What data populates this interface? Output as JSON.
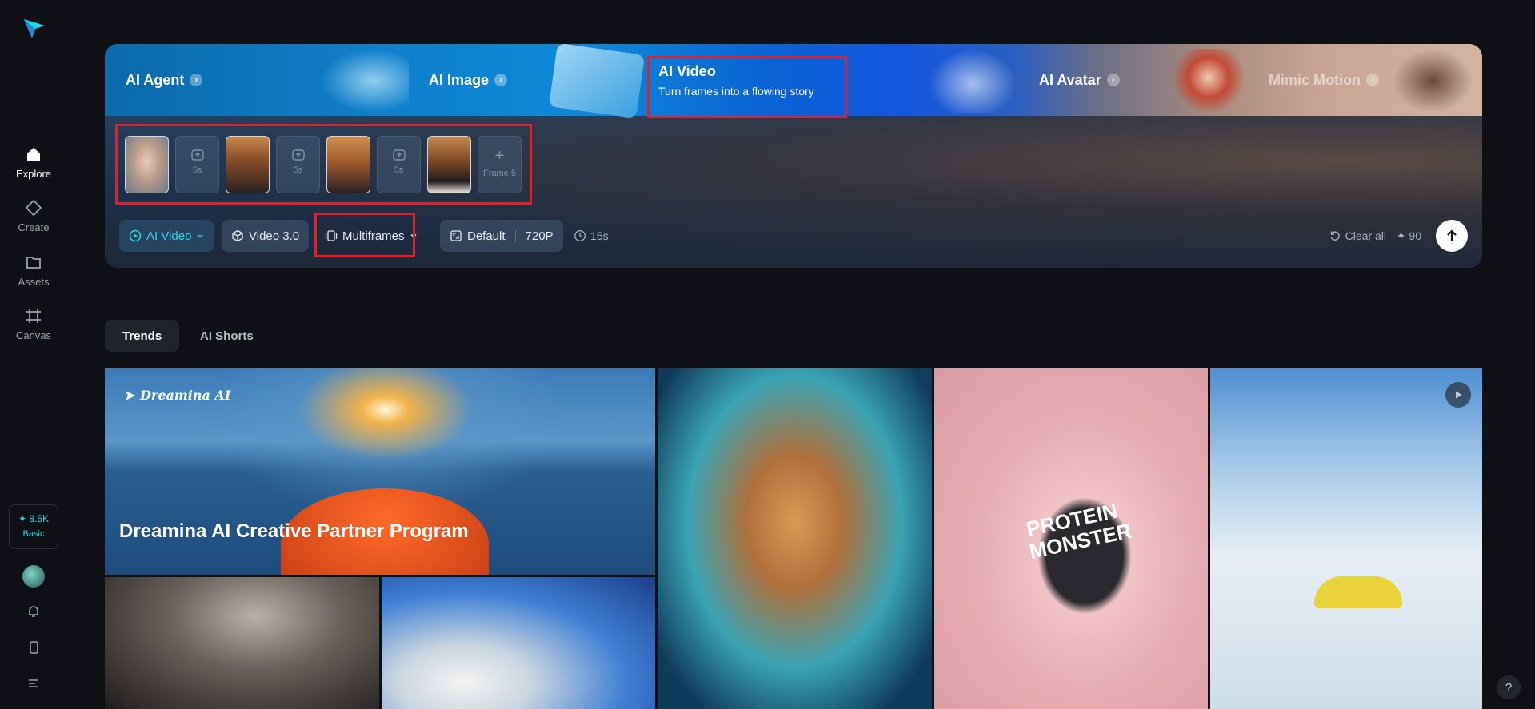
{
  "sidebar": {
    "nav": [
      {
        "label": "Explore",
        "icon": "home-icon"
      },
      {
        "label": "Create",
        "icon": "diamond-icon"
      },
      {
        "label": "Assets",
        "icon": "folder-icon"
      },
      {
        "label": "Canvas",
        "icon": "canvas-icon"
      }
    ],
    "credits": {
      "value": "✦ 8.5K",
      "tier": "Basic"
    }
  },
  "hero": {
    "tabs": [
      {
        "label": "AI Agent"
      },
      {
        "label": "AI Image"
      },
      {
        "label": "AI Video",
        "subtitle": "Turn frames into a flowing story"
      },
      {
        "label": "AI Avatar"
      },
      {
        "label": "Mimic Motion"
      }
    ],
    "frames": {
      "durations": [
        "5s",
        "5s",
        "5s"
      ],
      "add_label": "Frame 5"
    },
    "toolbar": {
      "mode": "AI Video",
      "model": "Video 3.0",
      "frame_mode": "Multiframes",
      "ratio": "Default",
      "resolution": "720P",
      "duration": "15s",
      "clear": "Clear all",
      "cost": "✦ 90"
    }
  },
  "feed": {
    "tabs": [
      "Trends",
      "AI Shorts"
    ],
    "featured": {
      "brand": "Dreamina AI",
      "title": "Dreamina AI Creative Partner Program"
    },
    "product_text": "PROTEIN MONSTER"
  },
  "colors": {
    "accent": "#29d3e6",
    "highlight_box": "#e0202a",
    "background": "#0e1014"
  }
}
